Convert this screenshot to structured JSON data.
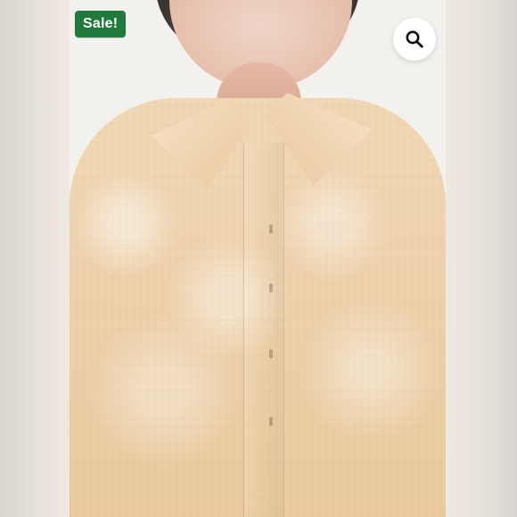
{
  "badges": {
    "sale": "Sale!"
  },
  "controls": {
    "zoom_icon": "search-icon"
  },
  "colors": {
    "sale_badge_bg": "#1f7a3b",
    "sale_badge_text": "#ffffff",
    "zoom_button_bg": "#ffffff",
    "zoom_icon": "#111111"
  }
}
